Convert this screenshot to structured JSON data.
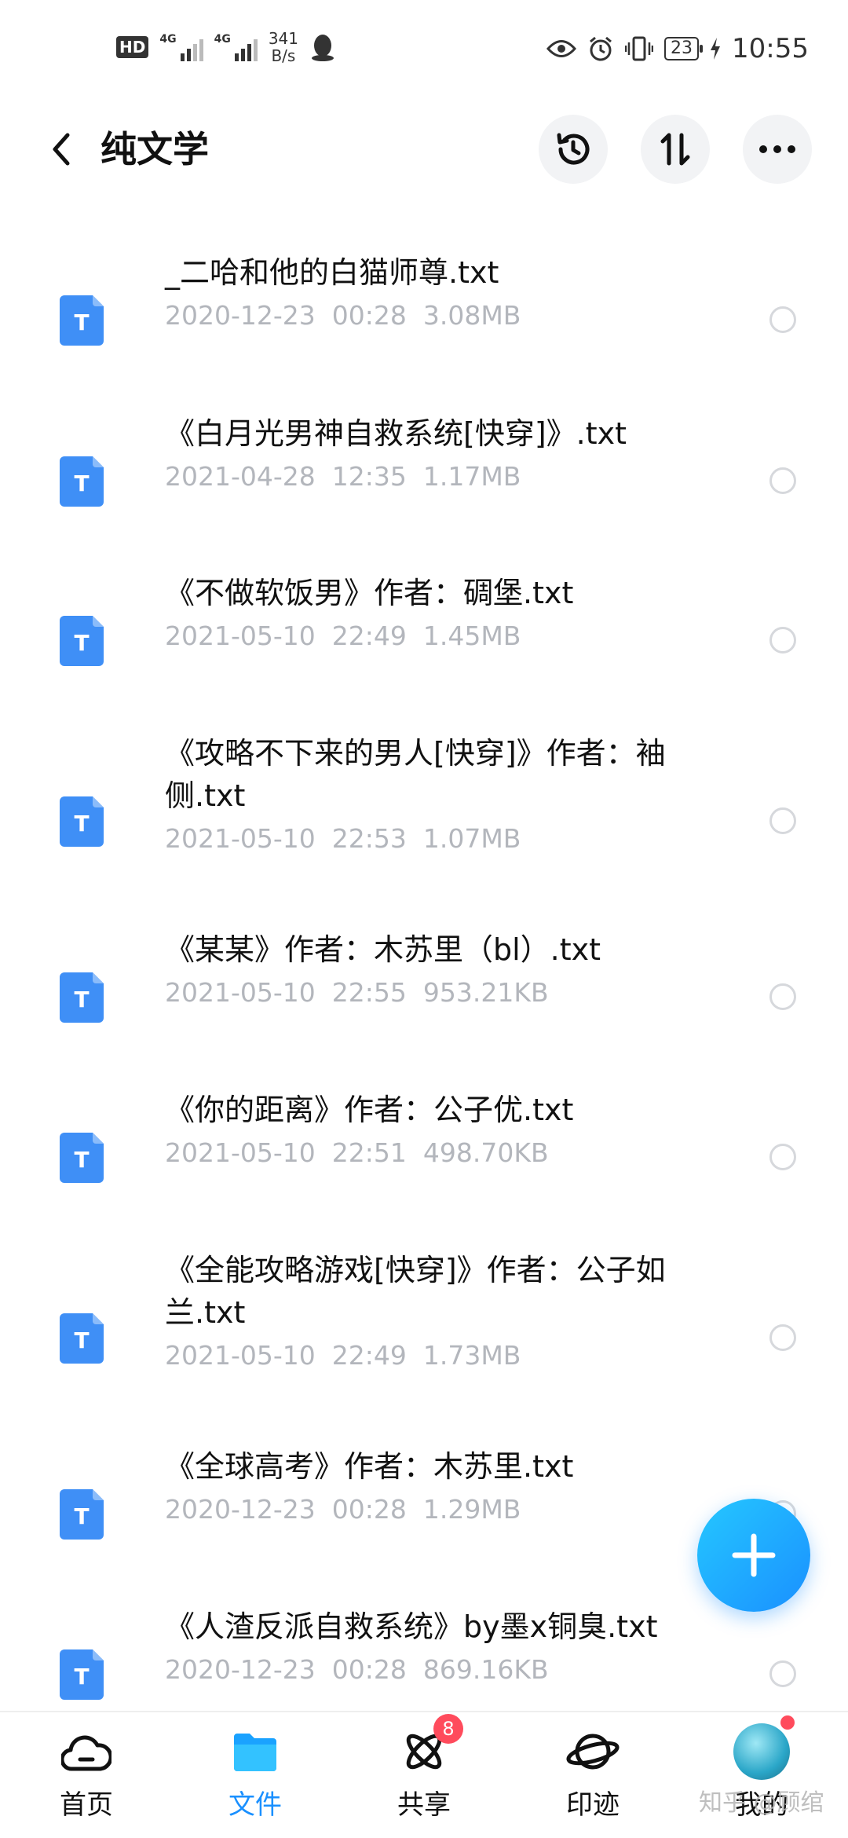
{
  "status_bar": {
    "hd_badge": "HD",
    "signal_1_label": "4G",
    "signal_2_label": "4G",
    "net_speed_value": "341",
    "net_speed_unit": "B/s",
    "battery": "23",
    "time": "10:55"
  },
  "header": {
    "title": "纯文学"
  },
  "files": [
    {
      "name": "_二哈和他的白猫师尊.txt",
      "date": "2020-12-23  00:28",
      "size": "3.08MB"
    },
    {
      "name": "《白月光男神自救系统[快穿]》.txt",
      "date": "2021-04-28  12:35",
      "size": "1.17MB"
    },
    {
      "name": "《不做软饭男》作者：碉堡.txt",
      "date": "2021-05-10  22:49",
      "size": "1.45MB"
    },
    {
      "name": "《攻略不下来的男人[快穿]》作者：袖侧.txt",
      "date": "2021-05-10  22:53",
      "size": "1.07MB"
    },
    {
      "name": "《某某》作者：木苏里（bl）.txt",
      "date": "2021-05-10  22:55",
      "size": "953.21KB"
    },
    {
      "name": "《你的距离》作者：公子优.txt",
      "date": "2021-05-10  22:51",
      "size": "498.70KB"
    },
    {
      "name": "《全能攻略游戏[快穿]》作者：公子如兰.txt",
      "date": "2021-05-10  22:49",
      "size": "1.73MB"
    },
    {
      "name": "《全球高考》作者：木苏里.txt",
      "date": "2020-12-23  00:28",
      "size": "1.29MB"
    },
    {
      "name": "《人渣反派自救系统》by墨x铜臭.txt",
      "date": "2020-12-23  00:28",
      "size": "869.16KB"
    }
  ],
  "file_icon_letter": "T",
  "colors": {
    "accent": "#1a90ff",
    "file_icon": "#3f8ff6",
    "meta_text": "#b3b6bc",
    "badge": "#ff4b5c"
  },
  "bottom_nav": {
    "items": [
      {
        "label": "首页",
        "icon": "home-cloud-icon"
      },
      {
        "label": "文件",
        "icon": "folder-icon",
        "active": true
      },
      {
        "label": "共享",
        "icon": "atom-share-icon",
        "badge": "8"
      },
      {
        "label": "印迹",
        "icon": "planet-icon"
      },
      {
        "label": "我的",
        "icon": "avatar"
      }
    ]
  },
  "watermark": "知乎 @顾绾"
}
